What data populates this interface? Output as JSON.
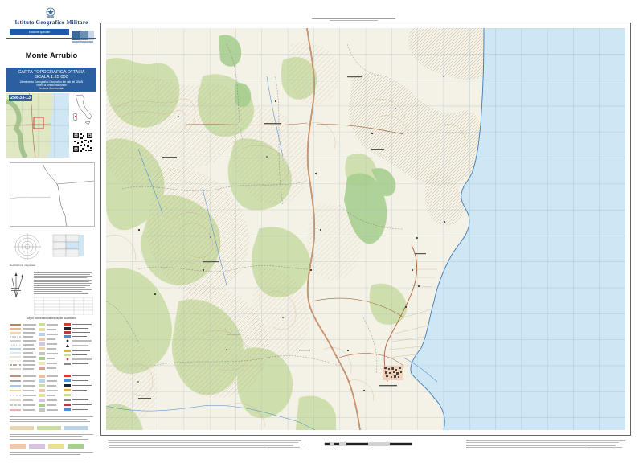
{
  "header": {
    "organization": "Istituto Geografico Militare",
    "edition_label": "Edizione speciale"
  },
  "sheet": {
    "title": "Monte Arrubio",
    "sheet_number": "25k-33-13"
  },
  "series_box": {
    "line1": "CARTA TOPOGRAFICA D'ITALIA",
    "line2": "SCALA 1:25 000",
    "line3": "Allestimento Cartografico Geografico dei dati del DBGN",
    "line4": "Rilievi di Ambito Nazionale",
    "line5": "Versione Sperimentale"
  },
  "legend": {
    "declination_caption": "Declinazione magnetica",
    "symbols_title": "Segni convenzionali ed usi del Dizionario"
  },
  "colors": {
    "sea": "#cfe6f5",
    "land": "#f4f1e6",
    "forest": "#c8dca4",
    "road": "#a9643a",
    "contour": "#c79a6b",
    "accent_blue": "#2c5f9e"
  }
}
